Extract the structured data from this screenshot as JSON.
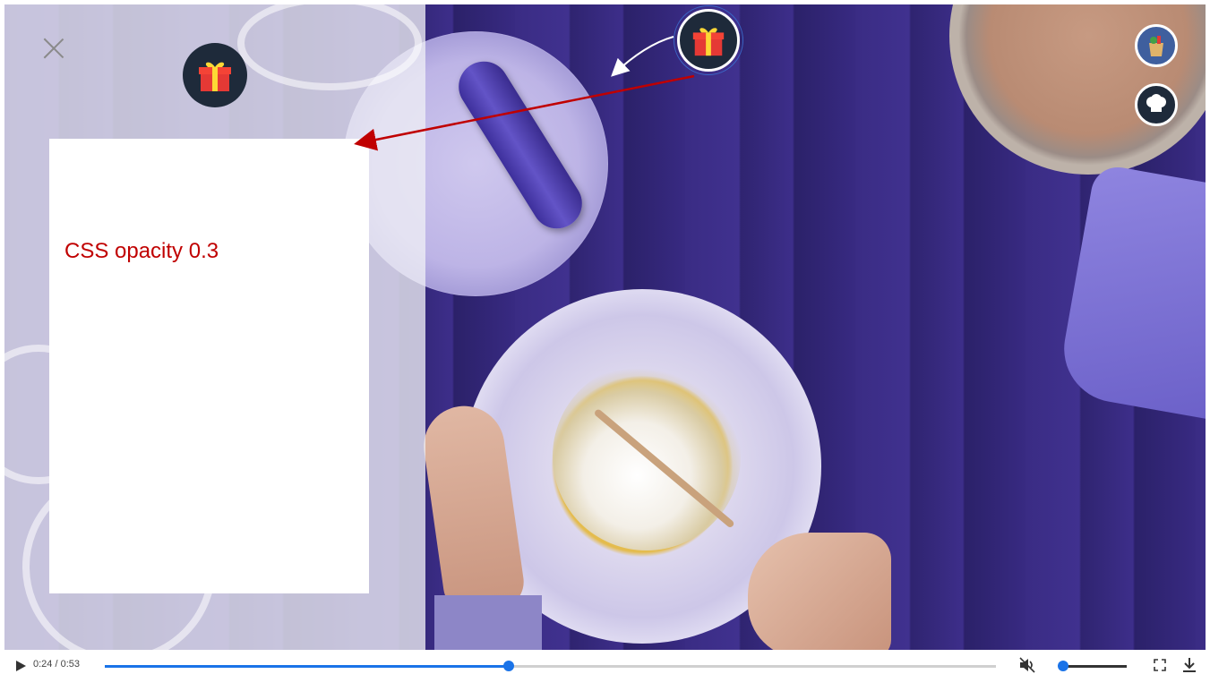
{
  "player": {
    "current_time": "0:24",
    "duration": "0:53",
    "time_display": "0:24 / 0:53",
    "progress_fraction": 0.453,
    "volume_fraction": 0.05,
    "muted": true
  },
  "overlay": {
    "panel_text": "CSS opacity 0.3"
  },
  "icons": {
    "close": "close-icon",
    "gift": "gift-icon",
    "grocery": "grocery-bag-icon",
    "chef": "chef-hat-icon",
    "play": "play-icon",
    "mute": "mute-icon",
    "fullscreen": "fullscreen-icon",
    "download": "download-icon"
  },
  "colors": {
    "accent": "#1a73e8",
    "annotation_red": "#c00000",
    "gift_bg": "#1e2a3a"
  }
}
